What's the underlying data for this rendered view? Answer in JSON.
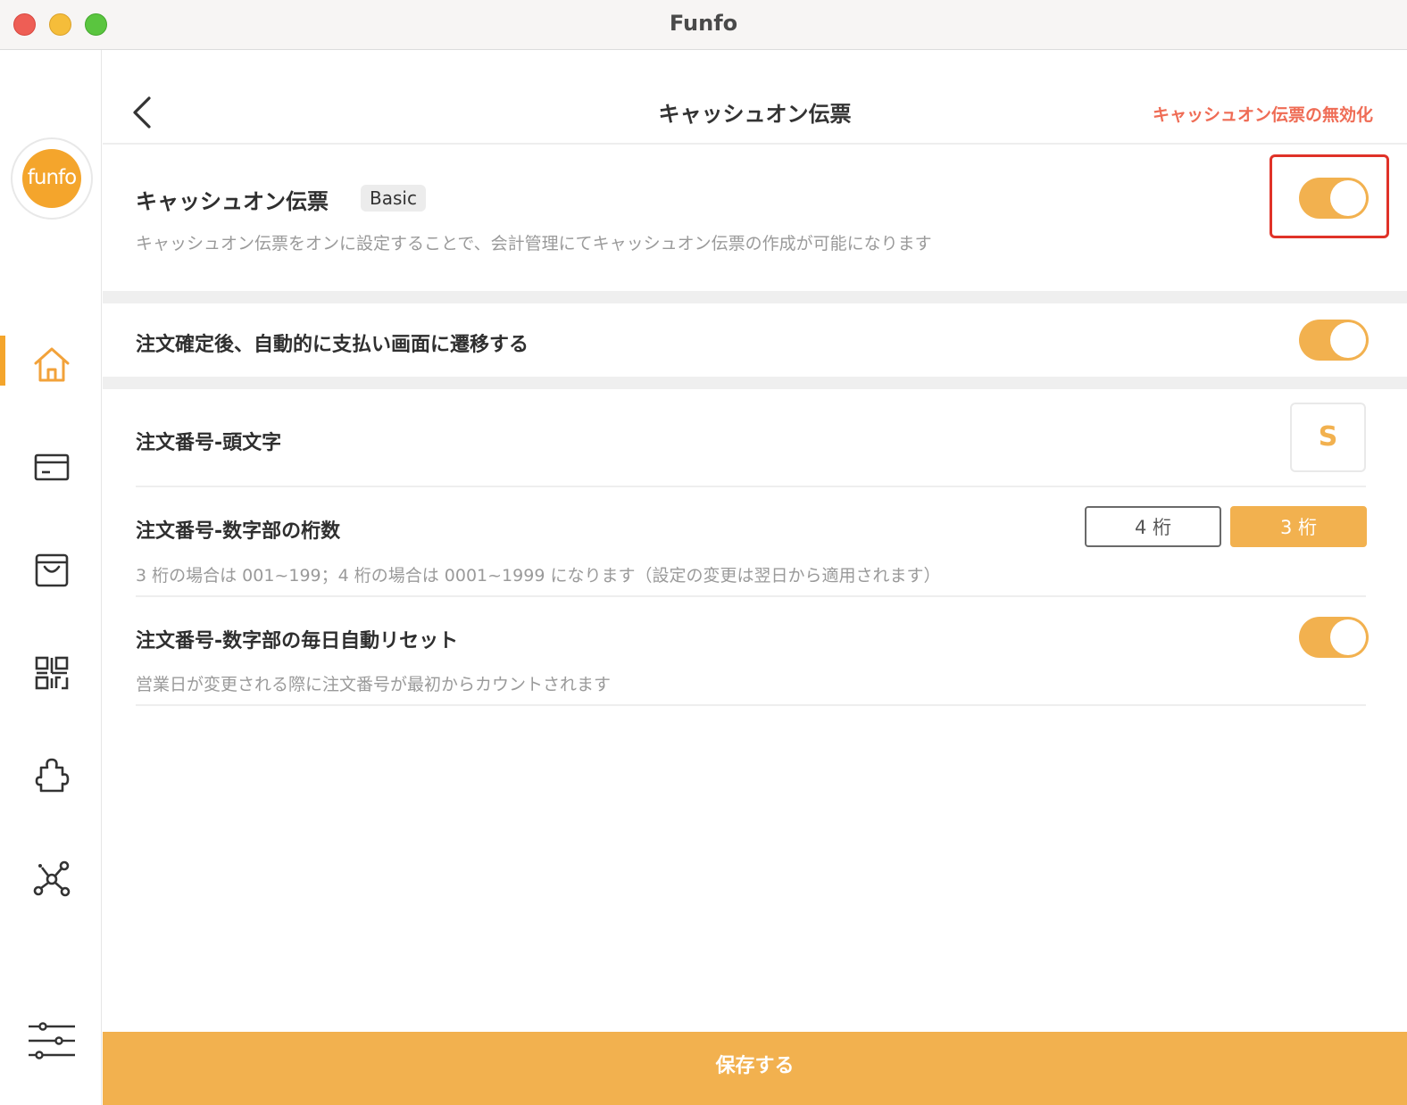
{
  "window": {
    "title": "Funfo"
  },
  "sidebar": {
    "logo_text": "funfo",
    "items": [
      {
        "icon": "home-icon",
        "active": true
      },
      {
        "icon": "card-icon",
        "active": false
      },
      {
        "icon": "bag-icon",
        "active": false
      },
      {
        "icon": "qr-code-icon",
        "active": false
      },
      {
        "icon": "puzzle-icon",
        "active": false
      },
      {
        "icon": "network-icon",
        "active": false
      },
      {
        "icon": "sliders-icon",
        "active": false
      }
    ]
  },
  "header": {
    "title": "キャッシュオン伝票",
    "action_label": "キャッシュオン伝票の無効化"
  },
  "cash_on": {
    "title": "キャッシュオン伝票",
    "badge": "Basic",
    "description": "キャッシュオン伝票をオンに設定することで、会計管理にてキャッシュオン伝票の作成が可能になります",
    "enabled": true
  },
  "auto_payment": {
    "title": "注文確定後、自動的に支払い画面に遷移する",
    "enabled": true
  },
  "order_prefix": {
    "title": "注文番号-頭文字",
    "value": "S"
  },
  "order_digits": {
    "title": "注文番号-数字部の桁数",
    "options": [
      "4 桁",
      "3 桁"
    ],
    "selected": "3 桁",
    "description": "3 桁の場合は 001~199；4 桁の場合は 0001~1999 になります（設定の変更は翌日から適用されます）"
  },
  "daily_reset": {
    "title": "注文番号-数字部の毎日自動リセット",
    "description": "営業日が変更される際に注文番号が最初からカウントされます",
    "enabled": true
  },
  "footer": {
    "save_label": "保存する"
  },
  "colors": {
    "accent": "#f2b14f",
    "danger": "#ef6c55",
    "highlight": "#e03228"
  }
}
